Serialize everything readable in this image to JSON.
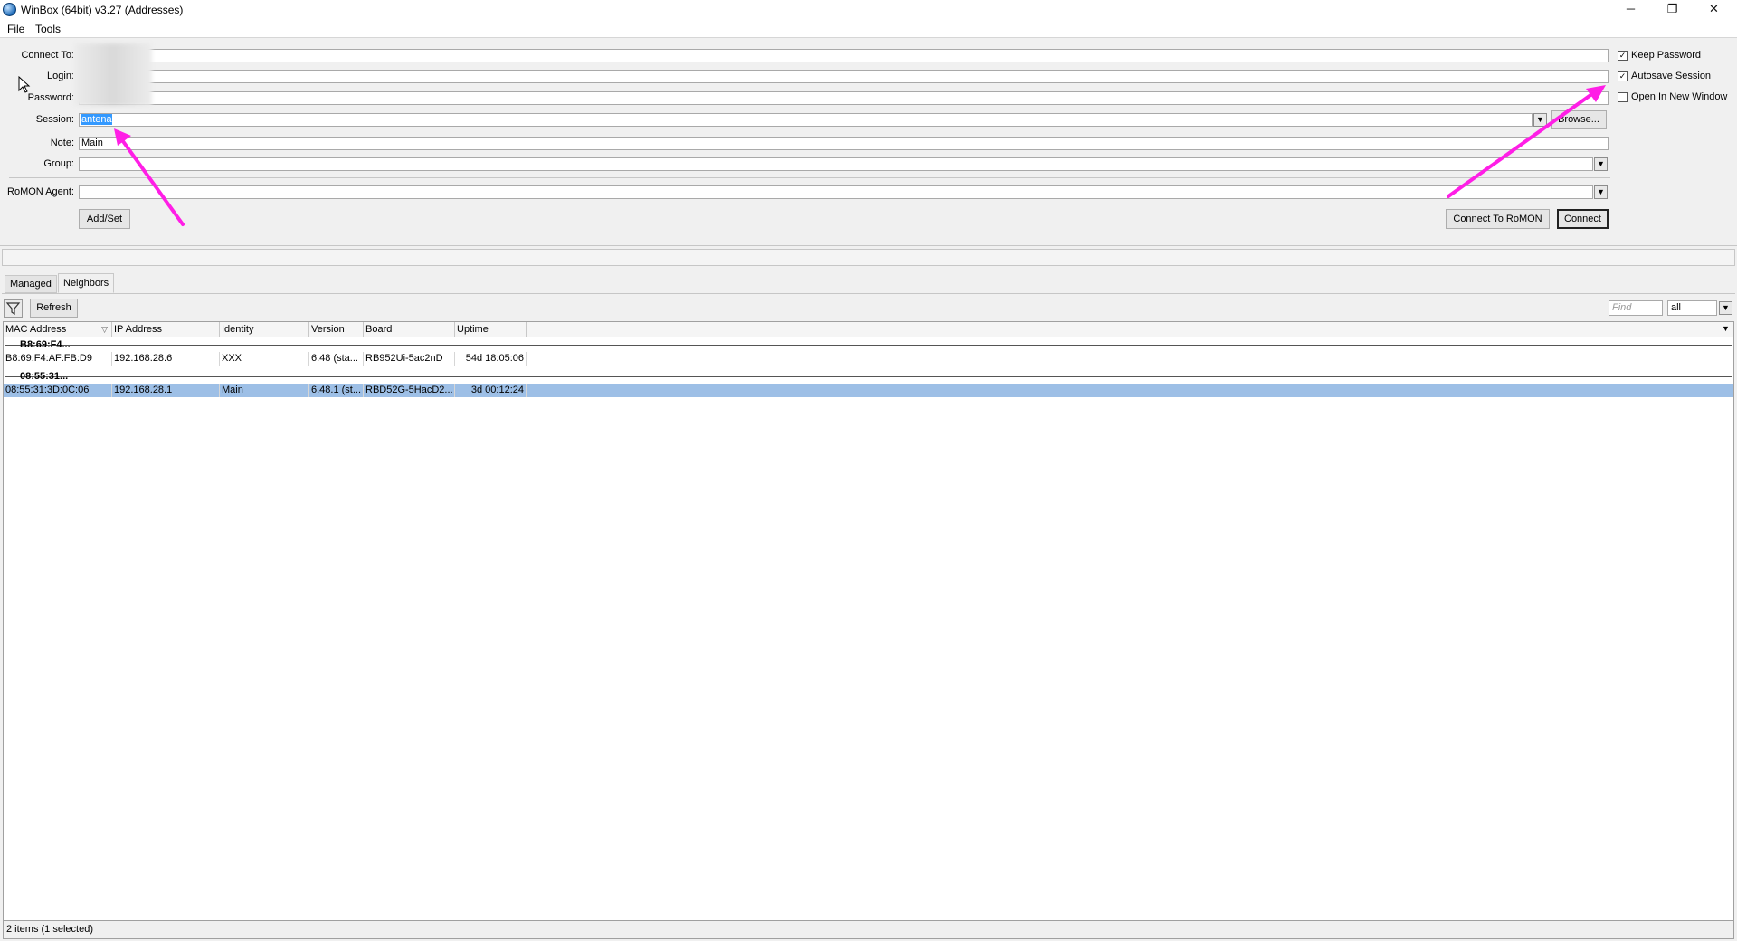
{
  "window": {
    "title": "WinBox (64bit) v3.27 (Addresses)",
    "minimize": "─",
    "restore": "❐",
    "close": "✕"
  },
  "menu": {
    "file": "File",
    "tools": "Tools"
  },
  "form": {
    "connect_to_label": "Connect To:",
    "login_label": "Login:",
    "password_label": "Password:",
    "session_label": "Session:",
    "session_value": "antena",
    "note_label": "Note:",
    "note_value": "Main",
    "group_label": "Group:",
    "romon_label": "RoMON Agent:",
    "browse_label": "Browse...",
    "addset_label": "Add/Set",
    "connect_romon_label": "Connect To RoMON",
    "connect_label": "Connect"
  },
  "options": {
    "keep_password": {
      "label": "Keep Password",
      "checked": true
    },
    "autosave_session": {
      "label": "Autosave Session",
      "checked": true
    },
    "open_new_window": {
      "label": "Open In New Window",
      "checked": false
    }
  },
  "tabs": {
    "managed": "Managed",
    "neighbors": "Neighbors"
  },
  "toolbar": {
    "refresh": "Refresh",
    "find_placeholder": "Find",
    "filter_value": "all"
  },
  "columns": [
    "MAC Address",
    "IP Address",
    "Identity",
    "Version",
    "Board",
    "Uptime"
  ],
  "groups": [
    {
      "header": "B8:69:F4...",
      "row": {
        "mac": "B8:69:F4:AF:FB:D9",
        "ip": "192.168.28.6",
        "identity": "XXX",
        "version": "6.48 (sta...",
        "board": "RB952Ui-5ac2nD",
        "uptime": "54d 18:05:06"
      }
    },
    {
      "header": "08:55:31...",
      "row": {
        "mac": "08:55:31:3D:0C:06",
        "ip": "192.168.28.1",
        "identity": "Main",
        "version": "6.48.1 (st...",
        "board": "RBD52G-5HacD2...",
        "uptime": "3d 00:12:24"
      }
    }
  ],
  "status": "2 items (1 selected)",
  "annotation_color": "#ff1ee6",
  "icons": {
    "filter": "funnel-icon",
    "dropdown": "dropdown-arrow-icon",
    "app": "winbox-globe-icon",
    "sort": "sort-indicator-icon"
  }
}
